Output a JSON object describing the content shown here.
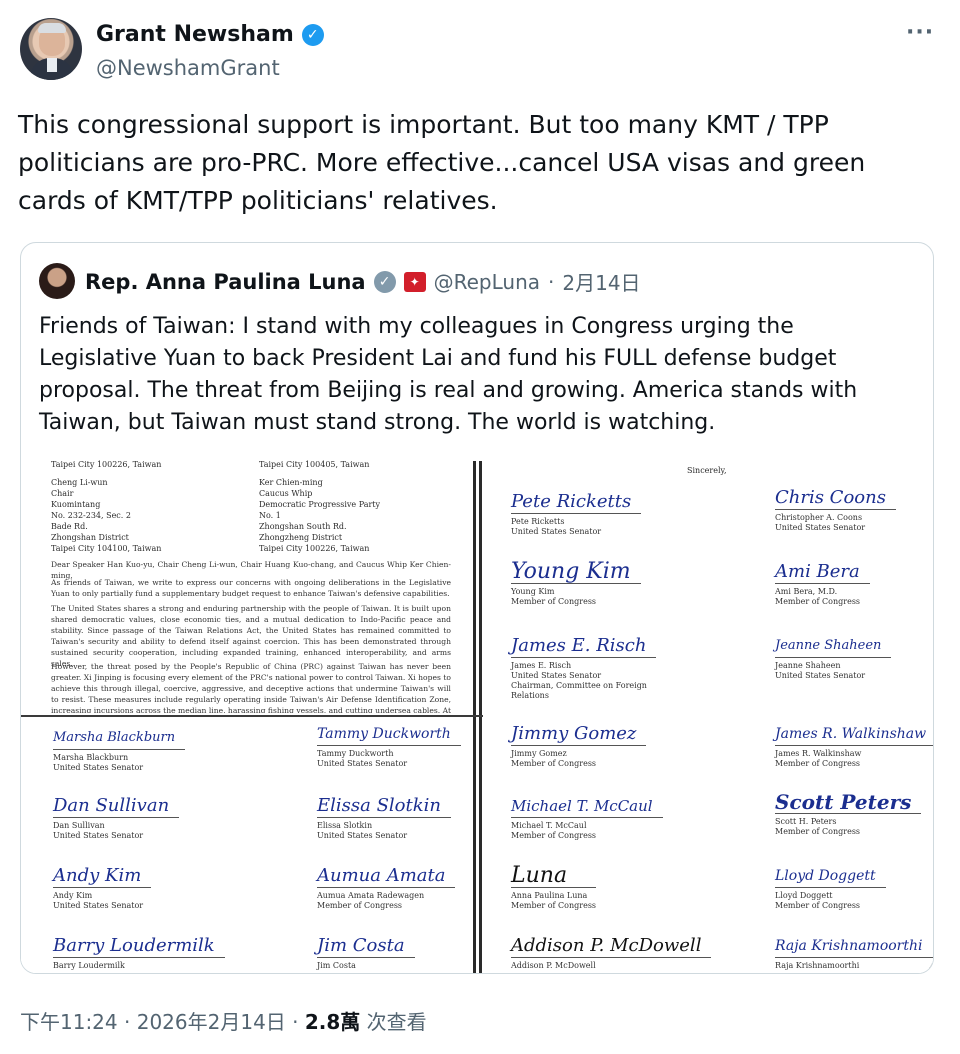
{
  "author": {
    "name": "Grant Newsham",
    "handle": "@NewshamGrant",
    "verified_icon": "verified-check-icon",
    "verified_color": "#1d9bf0"
  },
  "more_icon": "more-horizontal-icon",
  "tweet_text": "This congressional support is important. But too many KMT / TPP politicians are pro-PRC. More effective...cancel USA visas and green cards of KMT/TPP politicians' relatives.",
  "quote": {
    "name": "Rep. Anna Paulina Luna",
    "verified_icon": "verified-check-gray-icon",
    "flag_icon": "flag-emblem-icon",
    "handle": "@RepLuna",
    "separator": "·",
    "date": "2月14日",
    "text": "Friends of Taiwan: I stand with my colleagues in Congress urging the Legislative Yuan to back President Lai and fund his FULL defense budget proposal. The threat from Beijing is real and growing. America stands with Taiwan, but Taiwan must stand strong. The world is watching."
  },
  "letter": {
    "top_left_city": "Taipei City 100226, Taiwan",
    "top_right_city": "Taipei City 100405, Taiwan",
    "addr_left": "Cheng Li-wun\nChair\nKuomintang\nNo. 232-234, Sec. 2\nBade Rd.\nZhongshan District\nTaipei City 104100, Taiwan",
    "addr_right": "Ker Chien-ming\nCaucus Whip\nDemocratic Progressive Party\nNo. 1\nZhongshan South Rd.\nZhongzheng District\nTaipei City 100226, Taiwan",
    "salutation": "Dear Speaker Han Kuo-yu, Chair Cheng Li-wun, Chair Huang Kuo-chang, and Caucus Whip Ker Chien-ming,",
    "p1": "As friends of Taiwan, we write to express our concerns with ongoing deliberations in the Legislative Yuan to only partially fund a supplementary budget request to enhance Taiwan's defensive capabilities.",
    "p2": "The United States shares a strong and enduring partnership with the people of Taiwan. It is built upon shared democratic values, close economic ties, and a mutual dedication to Indo-Pacific peace and stability. Since passage of the Taiwan Relations Act, the United States has remained committed to Taiwan's security and ability to defend itself against coercion. This has been demonstrated through sustained security cooperation, including expanded training, enhanced interoperability, and arms sales.",
    "p3": "However, the threat posed by the People's Republic of China (PRC) against Taiwan has never been greater. Xi Jinping is focusing every element of the PRC's national power to control Taiwan. Xi hopes to achieve this through illegal, coercive, aggressive, and deceptive actions that undermine Taiwan's will to resist. These measures include regularly operating inside Taiwan's Air Defense Identification Zone, increasing incursions across the median line, harassing fishing vessels, and cutting undersea cables. At the same time, Xi remains",
    "sincerely": "Sincerely,",
    "left_sigs": [
      {
        "scrawl": "Marsha Blackburn",
        "name": "Marsha Blackburn",
        "title": "United States Senator"
      },
      {
        "scrawl": "Tammy Duckworth",
        "name": "Tammy Duckworth",
        "title": "United States Senator"
      },
      {
        "scrawl": "Dan Sullivan",
        "name": "Dan Sullivan",
        "title": "United States Senator"
      },
      {
        "scrawl": "Elissa Slotkin",
        "name": "Elissa Slotkin",
        "title": "United States Senator"
      },
      {
        "scrawl": "Andy Kim",
        "name": "Andy Kim",
        "title": "United States Senator"
      },
      {
        "scrawl": "Aumua Amata",
        "name": "Aumua Amata Radewagen",
        "title": "Member of Congress"
      },
      {
        "scrawl": "Barry Loudermilk",
        "name": "Barry Loudermilk",
        "title": ""
      },
      {
        "scrawl": "Jim Costa",
        "name": "Jim Costa",
        "title": ""
      }
    ],
    "right_sigs": [
      {
        "scrawl": "Pete Ricketts",
        "name": "Pete Ricketts",
        "title": "United States Senator"
      },
      {
        "scrawl": "Chris Coons",
        "name": "Christopher A. Coons",
        "title": "United States Senator"
      },
      {
        "scrawl": "Young Kim",
        "name": "Young Kim",
        "title": "Member of Congress"
      },
      {
        "scrawl": "Ami Bera",
        "name": "Ami Bera, M.D.",
        "title": "Member of Congress"
      },
      {
        "scrawl": "James E. Risch",
        "name": "James E. Risch",
        "title": "United States Senator"
      },
      {
        "scrawl": "Jeanne Shaheen",
        "name": "Jeanne Shaheen",
        "title": "United States Senator"
      },
      {
        "scrawl": "Jimmy Gomez",
        "name": "Jimmy Gomez",
        "title": "Member of Congress"
      },
      {
        "scrawl": "James R. Walkinshaw",
        "name": "James R. Walkinshaw",
        "title": "Member of Congress"
      },
      {
        "scrawl": "Michael T. McCaul",
        "name": "Michael T. McCaul",
        "title": "Member of Congress"
      },
      {
        "scrawl": "Scott Peters",
        "name": "Scott H. Peters",
        "title": "Member of Congress"
      },
      {
        "scrawl": "Luna",
        "name": "Anna Paulina Luna",
        "title": "Member of Congress"
      },
      {
        "scrawl": "Lloyd Doggett",
        "name": "Lloyd Doggett",
        "title": "Member of Congress"
      },
      {
        "scrawl": "Addison P. McDowell",
        "name": "Addison P. McDowell",
        "title": ""
      },
      {
        "scrawl": "Raja Krishnamoorthi",
        "name": "Raja Krishnamoorthi",
        "title": ""
      }
    ],
    "risch_extra": "Chairman, Committee on Foreign\nRelations"
  },
  "footer": {
    "time": "下午11:24",
    "sep1": " · ",
    "date": "2026年2月14日",
    "sep2": " · ",
    "views_count": "2.8萬",
    "views_label": " 次查看"
  }
}
